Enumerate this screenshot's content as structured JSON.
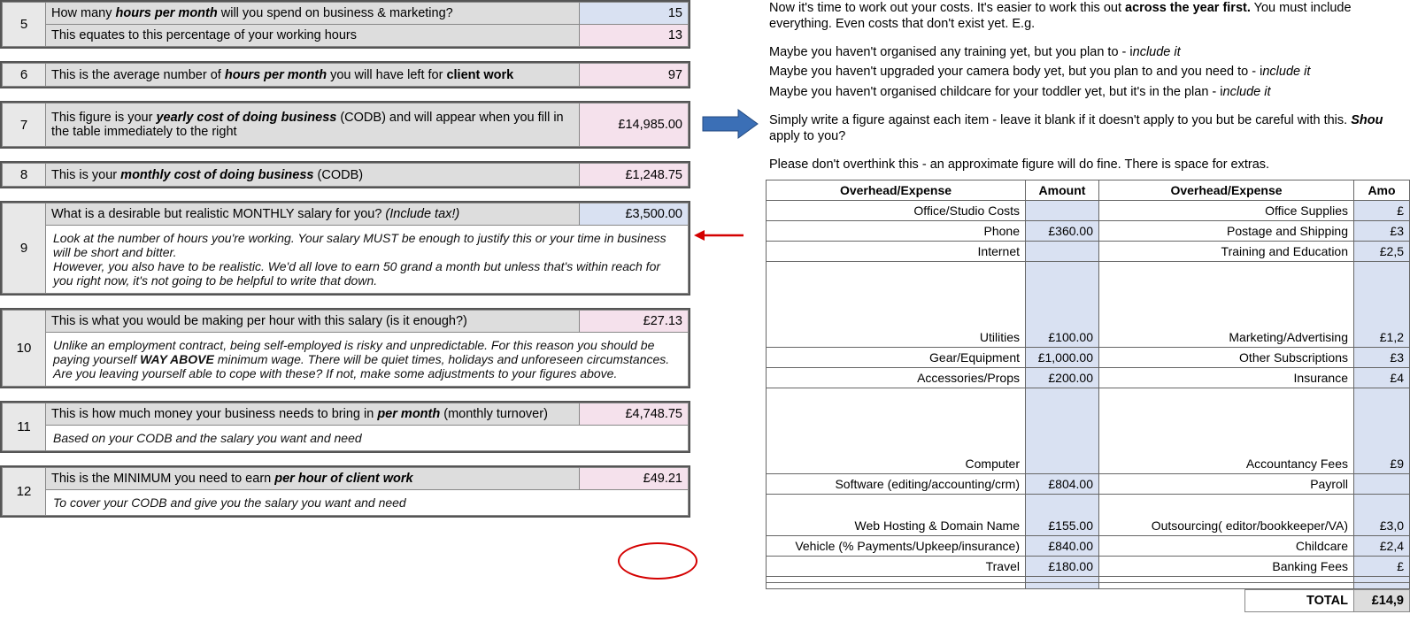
{
  "left": {
    "row5": {
      "num": "5",
      "q1": "How many hours per month will you spend on business & marketing?",
      "v1": "15",
      "q2": "This equates to this percentage of your working hours",
      "v2": "13"
    },
    "row6": {
      "num": "6",
      "q": "This is the average number of hours per month you will have left for client work",
      "v": "97"
    },
    "row7": {
      "num": "7",
      "q": "This figure is your yearly cost of doing business (CODB) and will appear when you fill in the table immediately to the right",
      "v": "£14,985.00"
    },
    "row8": {
      "num": "8",
      "q": "This is your monthly cost of doing business (CODB)",
      "v": "£1,248.75"
    },
    "row9": {
      "num": "9",
      "q": "What is a desirable but realistic MONTHLY salary for you? (Include tax!)",
      "v": "£3,500.00",
      "note": "Look at the number of hours you're working. Your salary MUST be enough to justify this or your time in business will be short and bitter.\nHowever, you also have to be realistic. We'd all love to earn 50 grand a month but unless that's within reach for you right now, it's not going to be helpful to write that down."
    },
    "row10": {
      "num": "10",
      "q": "This is what you would be making per hour with this salary (is it enough?)",
      "v": "£27.13",
      "note": "Unlike an employment contract, being self-employed is risky and unpredictable. For this reason you should be paying yourself WAY ABOVE minimum wage. There will be quiet times, holidays and unforeseen circumstances. Are you leaving yourself able to cope with these? If not, make some adjustments to your figures above."
    },
    "row11": {
      "num": "11",
      "q": "This is how much money your business needs to bring in per month (monthly turnover)",
      "v": "£4,748.75",
      "note": "Based on your CODB and the salary you want and need"
    },
    "row12": {
      "num": "12",
      "q": "This is the MINIMUM you need to earn per hour of client work",
      "v": "£49.21",
      "note": "To cover your CODB and give you the salary you want and need"
    }
  },
  "right": {
    "intro1": "Now it's time to work out your costs. It's easier to work this out across the year first. You must include everything. Even costs that don't exist yet. E.g.",
    "intro2a": "Maybe you haven't organised any training yet, but you plan to - include it",
    "intro2b": "Maybe you haven't upgraded your camera body yet, but you plan to and you need to - include it",
    "intro2c": "Maybe you haven't organised childcare for your toddler yet, but it's in the plan - include it",
    "intro3": "Simply write a figure against each item - leave it blank if it doesn't apply to you but be careful with this. Should it apply to you?",
    "intro4": "Please don't overthink this - an approximate figure will do fine. There is space for extras.",
    "headers": {
      "h1": "Overhead/Expense",
      "h2": "Amount",
      "h3": "Overhead/Expense",
      "h4": "Amo"
    },
    "rows": [
      {
        "a": "Office/Studio Costs",
        "av": "",
        "b": "Office Supplies",
        "bv": "£"
      },
      {
        "a": "Phone",
        "av": "£360.00",
        "b": "Postage and Shipping",
        "bv": "£3"
      },
      {
        "a": "Internet",
        "av": "",
        "b": "Training and Education",
        "bv": "£2,5"
      },
      {
        "a": "Utilities",
        "av": "£100.00",
        "b": "Marketing/Advertising",
        "bv": "£1,2",
        "tall": true
      },
      {
        "a": "Gear/Equipment",
        "av": "£1,000.00",
        "b": "Other Subscriptions",
        "bv": "£3"
      },
      {
        "a": "Accessories/Props",
        "av": "£200.00",
        "b": "Insurance",
        "bv": "£4"
      },
      {
        "a": "Computer",
        "av": "",
        "b": "Accountancy Fees",
        "bv": "£9",
        "tall": true
      },
      {
        "a": "Software (editing/accounting/crm)",
        "av": "£804.00",
        "b": "Payroll",
        "bv": ""
      },
      {
        "a": "Web Hosting & Domain Name",
        "av": "£155.00",
        "b": "Outsourcing( editor/bookkeeper/VA)",
        "bv": "£3,0",
        "med": true
      },
      {
        "a": "Vehicle (% Payments/Upkeep/insurance)",
        "av": "£840.00",
        "b": "Childcare",
        "bv": "£2,4"
      },
      {
        "a": "Travel",
        "av": "£180.00",
        "b": "Banking Fees",
        "bv": "£"
      },
      {
        "a": "",
        "av": "",
        "b": "",
        "bv": ""
      },
      {
        "a": "",
        "av": "",
        "b": "",
        "bv": ""
      }
    ],
    "total_label": "TOTAL",
    "total_value": "£14,9"
  }
}
